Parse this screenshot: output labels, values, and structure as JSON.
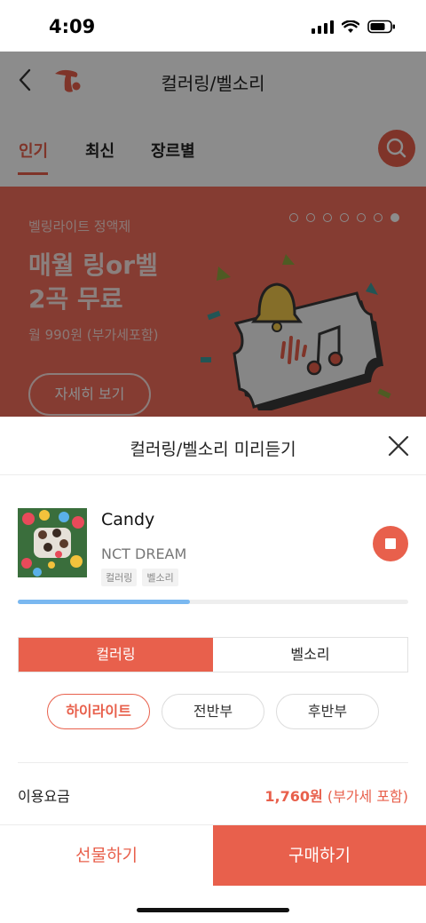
{
  "status": {
    "time": "4:09"
  },
  "app": {
    "title": "컬러링/벨소리",
    "tabs": [
      {
        "label": "인기",
        "active": true
      },
      {
        "label": "최신",
        "active": false
      },
      {
        "label": "장르별",
        "active": false
      }
    ],
    "banner": {
      "subtitle": "벨링라이트 정액제",
      "title_line1": "매월 링or벨",
      "title_line2": "2곡 무료",
      "price": "월 990원 (부가세포함)",
      "button_label": "자세히 보기",
      "page_count": 7,
      "current_page": 7
    }
  },
  "sheet": {
    "title": "컬러링/벨소리 미리듣기",
    "track": {
      "title": "Candy",
      "artist": "NCT DREAM",
      "tags": [
        "컬러링",
        "벨소리"
      ]
    },
    "progress": 0.44,
    "segments": [
      {
        "label": "컬러링",
        "active": true
      },
      {
        "label": "벨소리",
        "active": false
      }
    ],
    "parts": [
      {
        "label": "하이라이트",
        "active": true
      },
      {
        "label": "전반부",
        "active": false
      },
      {
        "label": "후반부",
        "active": false
      }
    ],
    "fee_label": "이용요금",
    "fee_amount": "1,760원",
    "fee_note": "(부가세 포함)",
    "gift_label": "선물하기",
    "buy_label": "구매하기"
  },
  "colors": {
    "accent": "#e8604c",
    "progress": "#7ab8f0",
    "banner": "#f26e5c"
  }
}
